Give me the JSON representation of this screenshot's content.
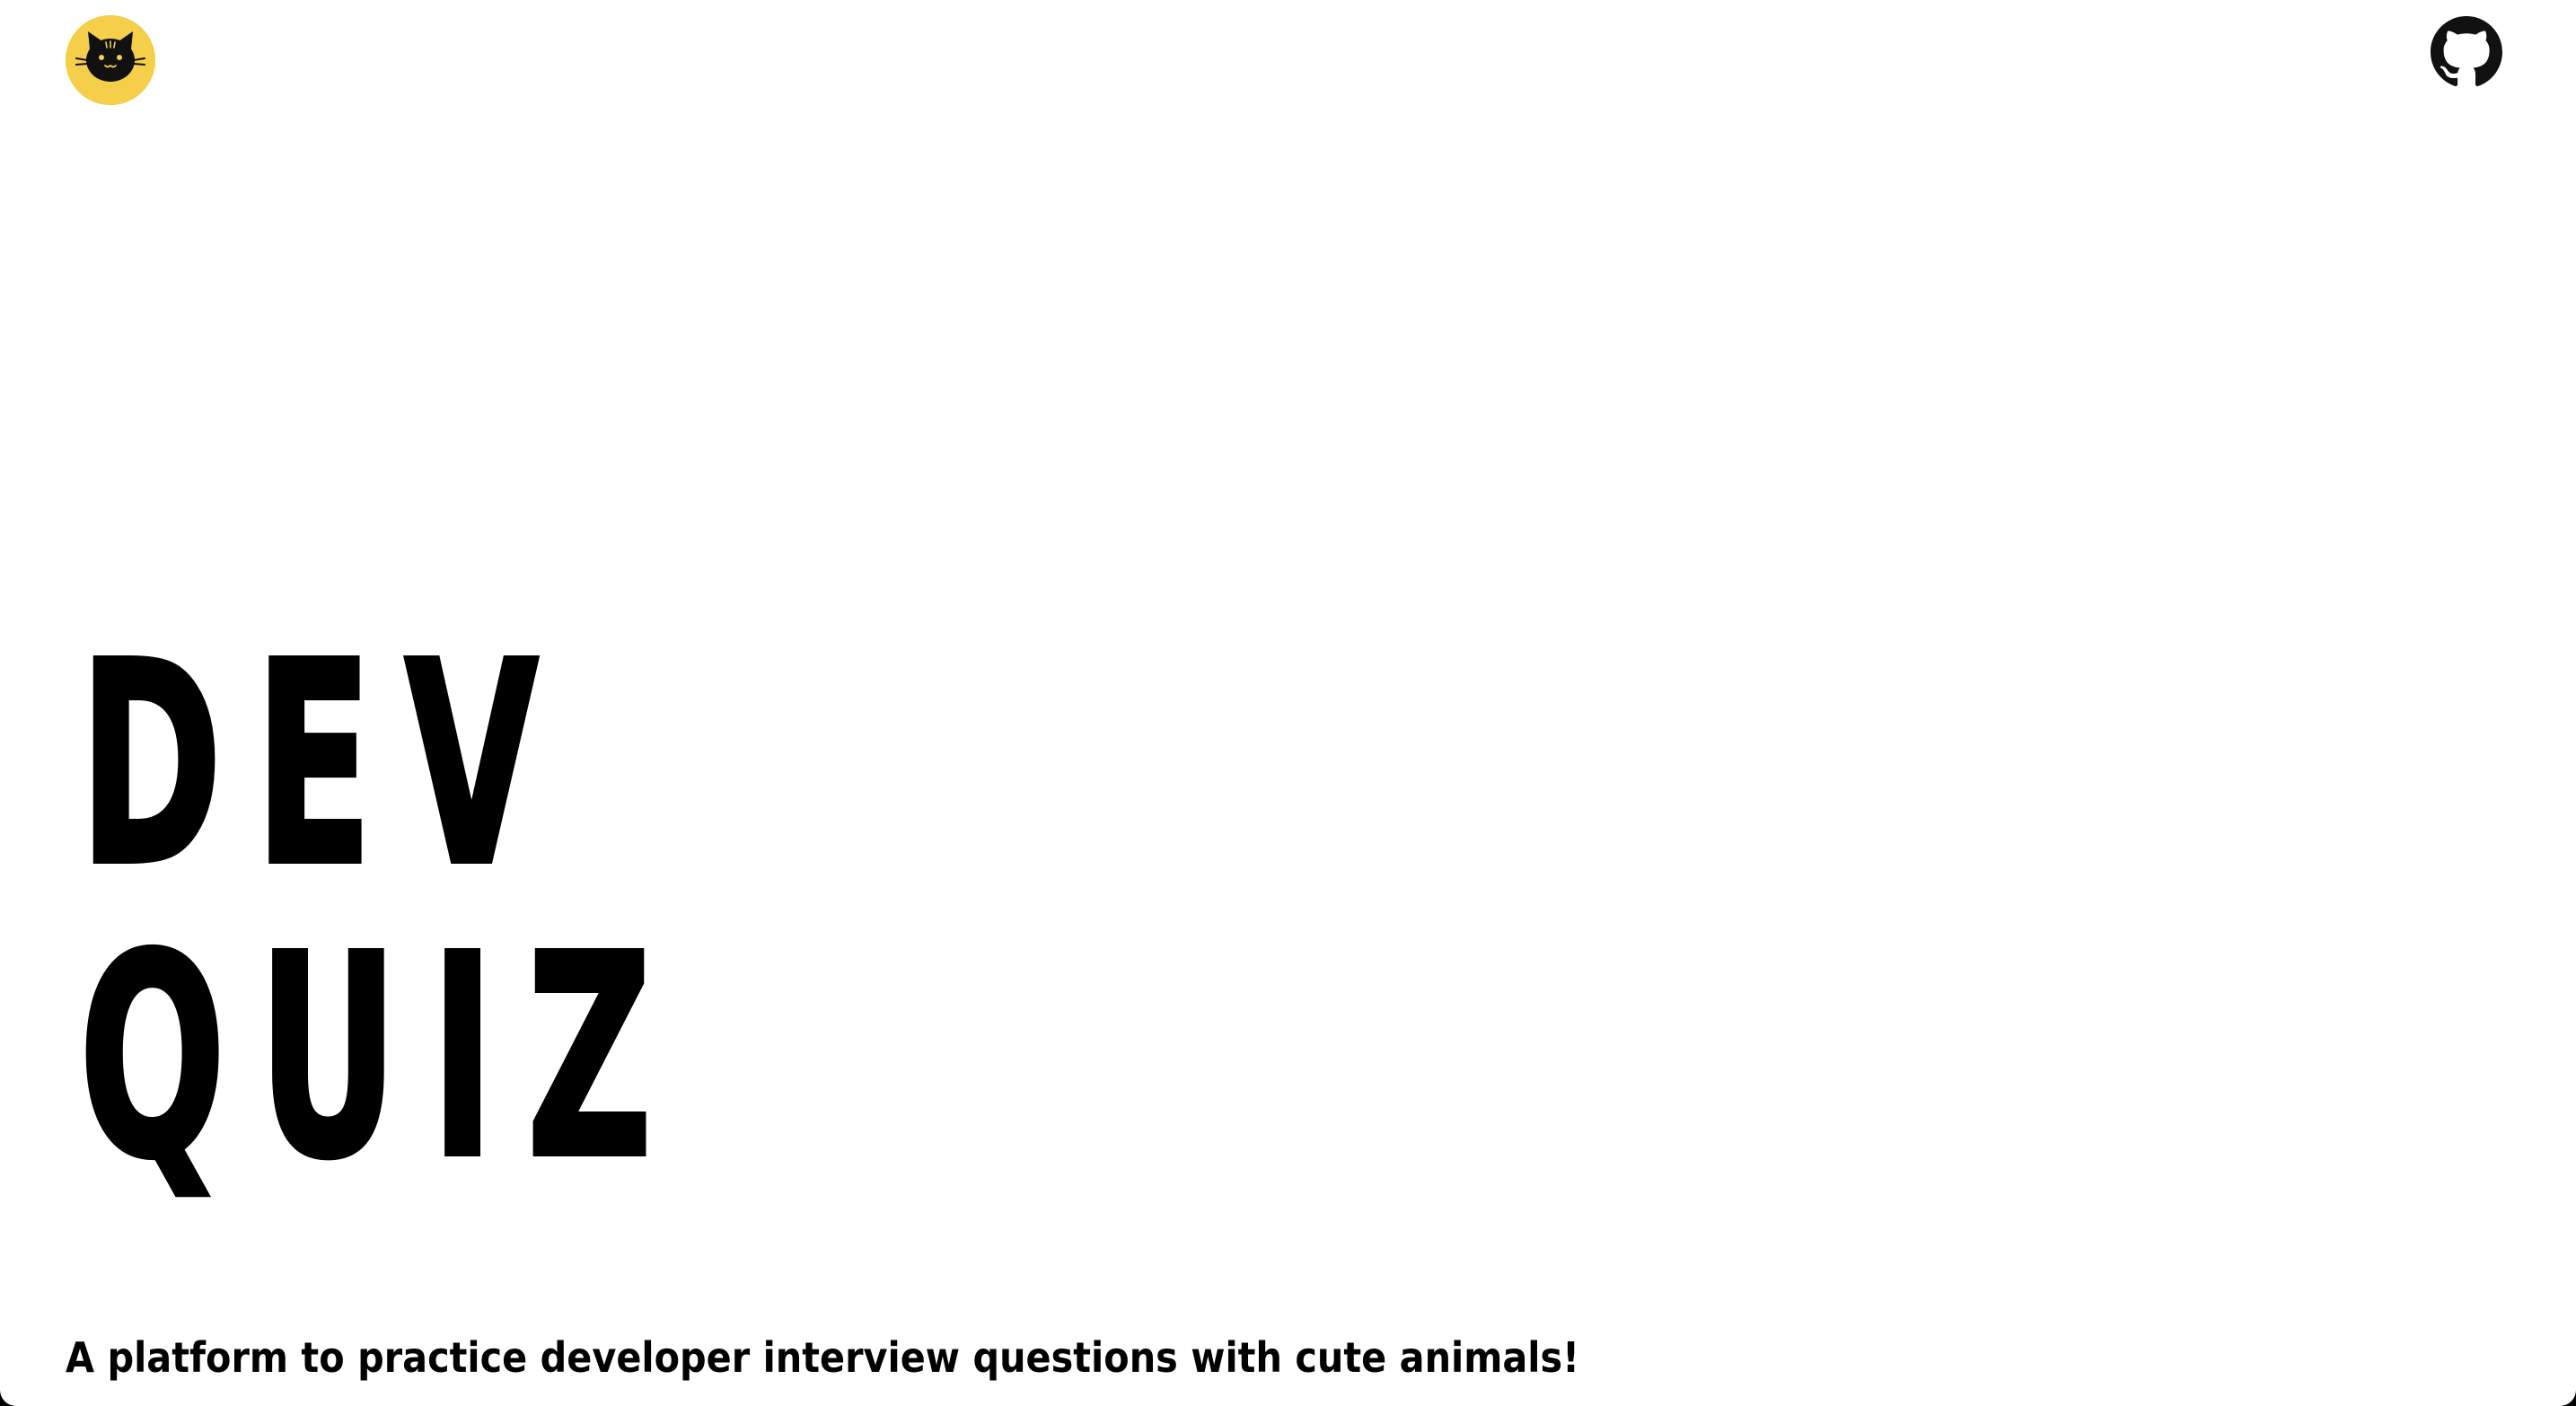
{
  "header": {
    "logo_icon": "cat-face-icon",
    "logo_color": "#f5cf4a",
    "github_icon": "github-icon"
  },
  "hero": {
    "title_line1": "DEV",
    "title_line2": "QUIZ",
    "tagline": "A platform to practice developer interview questions with cute animals!"
  },
  "colors": {
    "background": "#ffffff",
    "text": "#000000",
    "accent": "#f5cf4a"
  }
}
